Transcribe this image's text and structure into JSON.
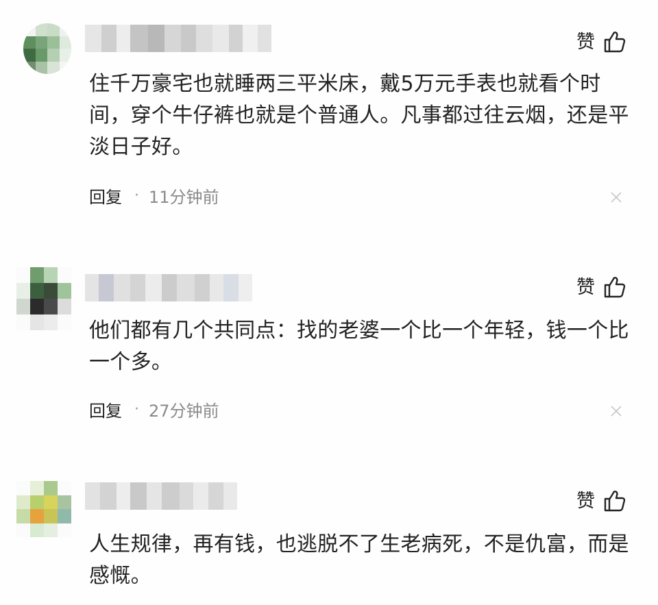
{
  "comments": [
    {
      "like_label": "赞",
      "text": "住千万豪宅也就睡两三平米床，戴5万元手表也就看个时间，穿个牛仔裤也就是个普通人。凡事都过往云烟，还是平淡日子好。",
      "reply_label": "回复",
      "separator": "·",
      "time": "11分钟前"
    },
    {
      "like_label": "赞",
      "text": "他们都有几个共同点：找的老婆一个比一个年轻，钱一个比一个多。",
      "reply_label": "回复",
      "separator": "·",
      "time": "27分钟前"
    },
    {
      "like_label": "赞",
      "text": "人生规律，再有钱，也逃脱不了生老病死，不是仇富，而是感慨。"
    }
  ],
  "icons": {
    "like": "thumbs-up-icon",
    "dismiss": "close-icon"
  },
  "colors": {
    "text": "#222222",
    "meta_time": "#8a8a8a",
    "close_icon": "#c8c8c8"
  }
}
